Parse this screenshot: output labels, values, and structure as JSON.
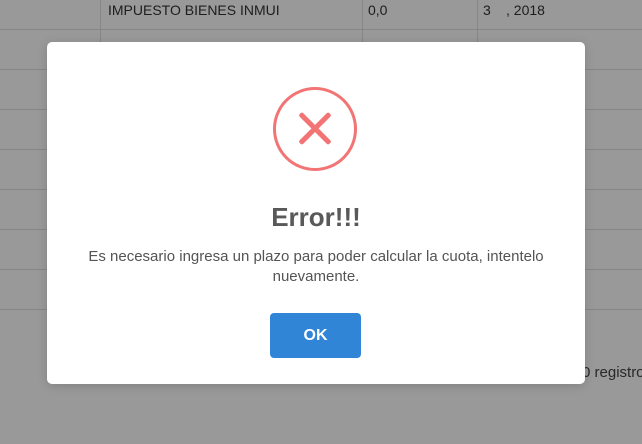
{
  "background": {
    "table_first_row": {
      "concept": "IMPUESTO BIENES INMUI",
      "value": "0,0",
      "period_num": "3",
      "period_year": ", 2018"
    },
    "footer_text": "0 registro"
  },
  "dialog": {
    "icon": "error-x-circle-icon",
    "title": "Error!!!",
    "message": "Es necesario ingresa un plazo para poder calcular la cuota, intentelo nuevamente.",
    "ok_label": "OK",
    "colors": {
      "icon": "#f27474",
      "button": "#3085d6",
      "title": "#595959"
    }
  }
}
